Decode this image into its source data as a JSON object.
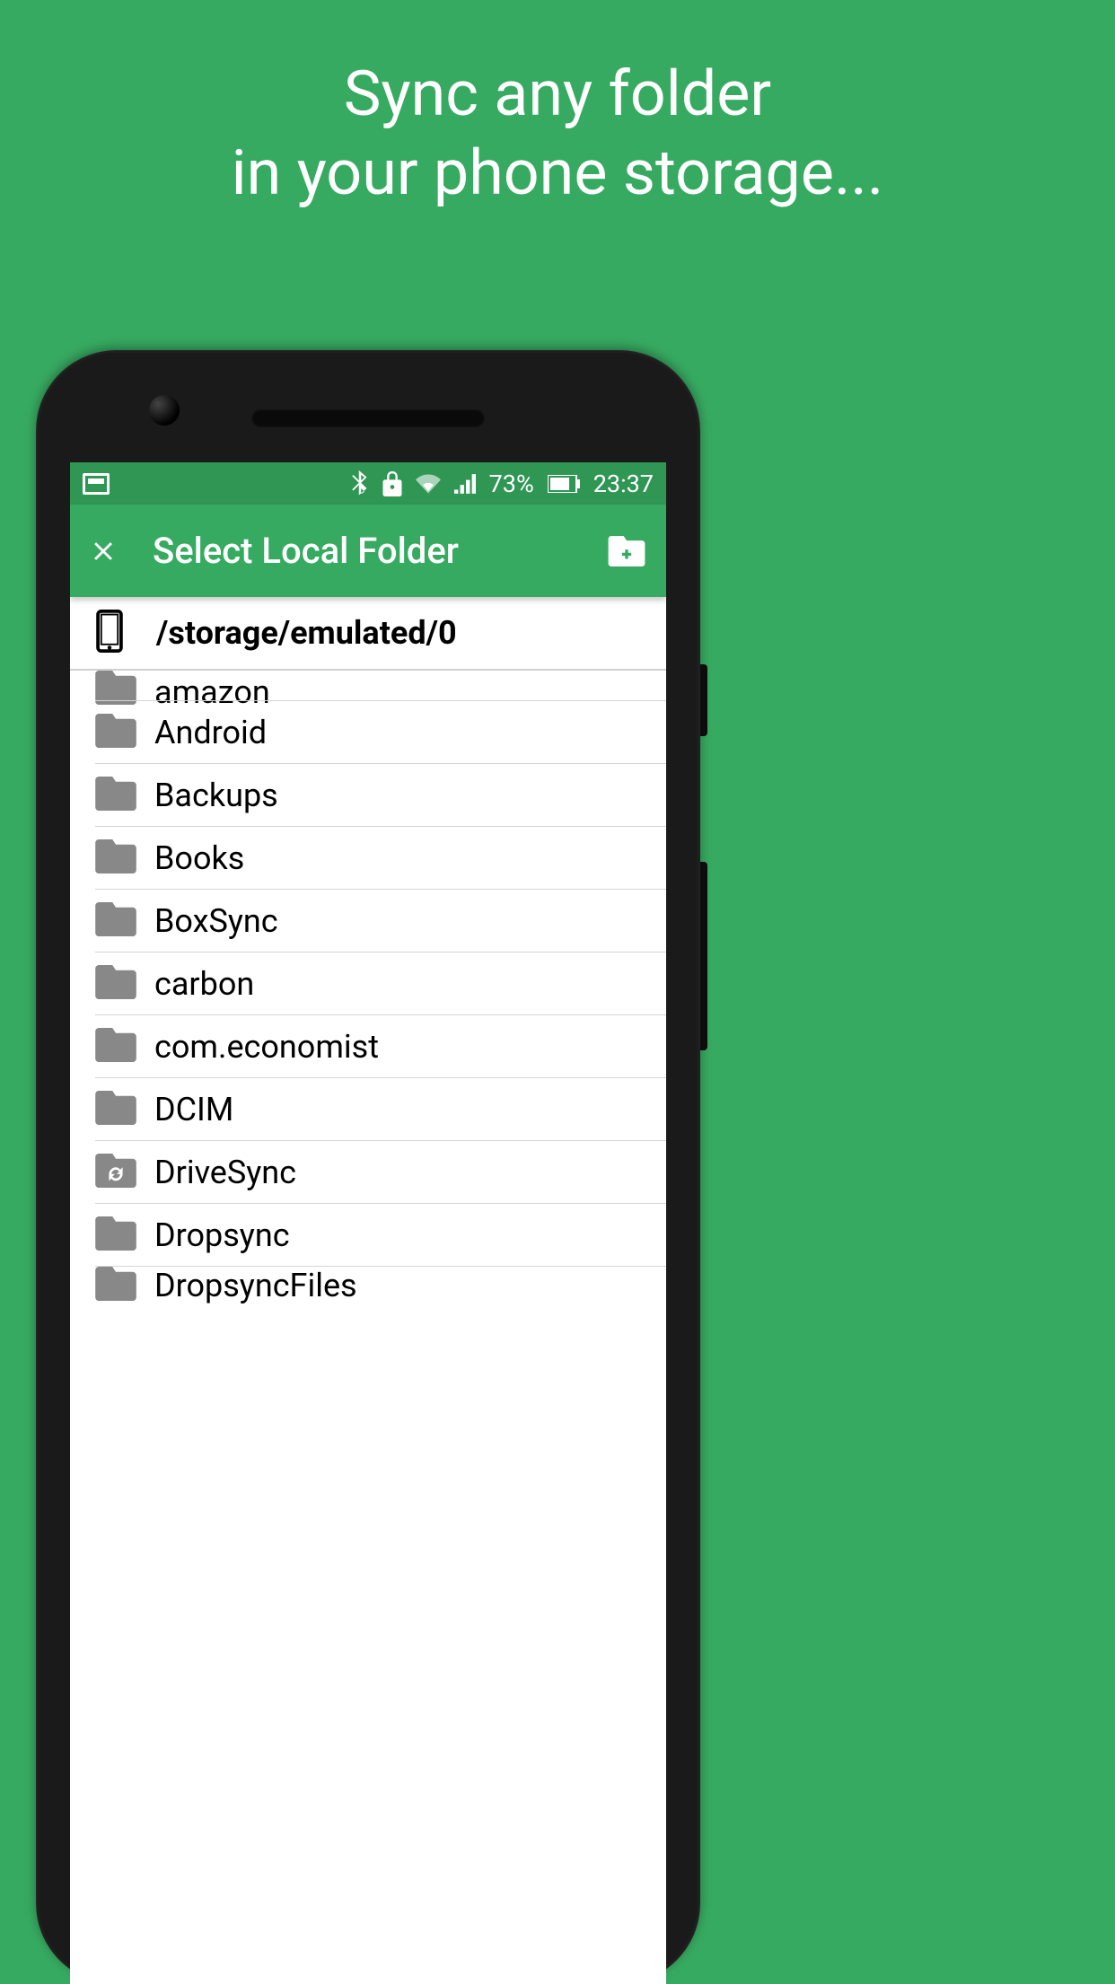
{
  "promo": {
    "line1": "Sync any folder",
    "line2": "in your phone storage..."
  },
  "status": {
    "battery_pct": "73%",
    "time": "23:37"
  },
  "appbar": {
    "title": "Select Local Folder"
  },
  "path": {
    "current": "/storage/emulated/0"
  },
  "folders": [
    {
      "name": "amazon",
      "icon": "folder",
      "clipped": true
    },
    {
      "name": "Android",
      "icon": "folder"
    },
    {
      "name": "Backups",
      "icon": "folder"
    },
    {
      "name": "Books",
      "icon": "folder"
    },
    {
      "name": "BoxSync",
      "icon": "folder"
    },
    {
      "name": "carbon",
      "icon": "folder"
    },
    {
      "name": "com.economist",
      "icon": "folder"
    },
    {
      "name": "DCIM",
      "icon": "folder"
    },
    {
      "name": "DriveSync",
      "icon": "folder-sync"
    },
    {
      "name": "Dropsync",
      "icon": "folder"
    },
    {
      "name": "DropsyncFiles",
      "icon": "folder",
      "lastclip": true
    }
  ]
}
